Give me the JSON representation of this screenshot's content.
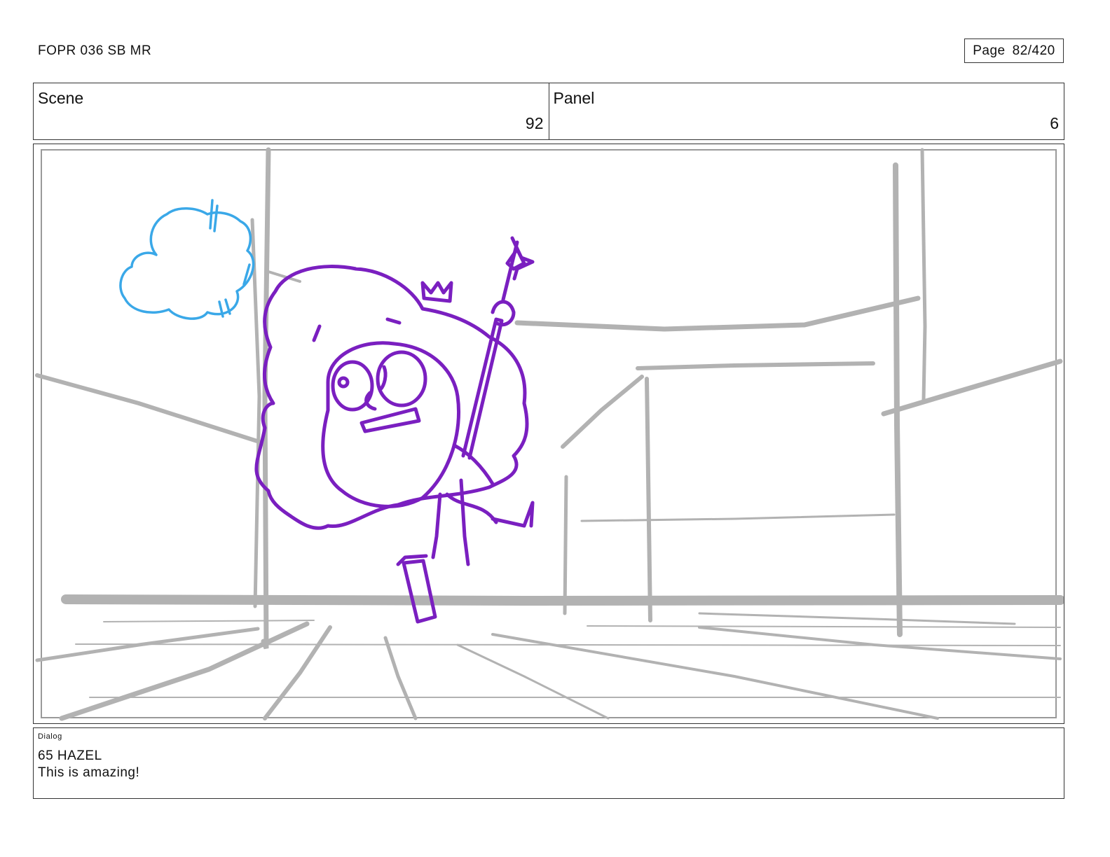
{
  "header": {
    "doc_title": "FOPR 036 SB MR",
    "page_label": "Page",
    "page_number": "82/420"
  },
  "info": {
    "scene_label": "Scene",
    "scene_value": "92",
    "panel_label": "Panel",
    "panel_value": "6"
  },
  "artwork": {
    "background_color": "#b2b2b2",
    "character_color": "#7a1fc0",
    "cloud_color": "#3aa8e8"
  },
  "dialog": {
    "label": "Dialog",
    "speaker": "65 HAZEL",
    "line": "This is amazing!"
  }
}
